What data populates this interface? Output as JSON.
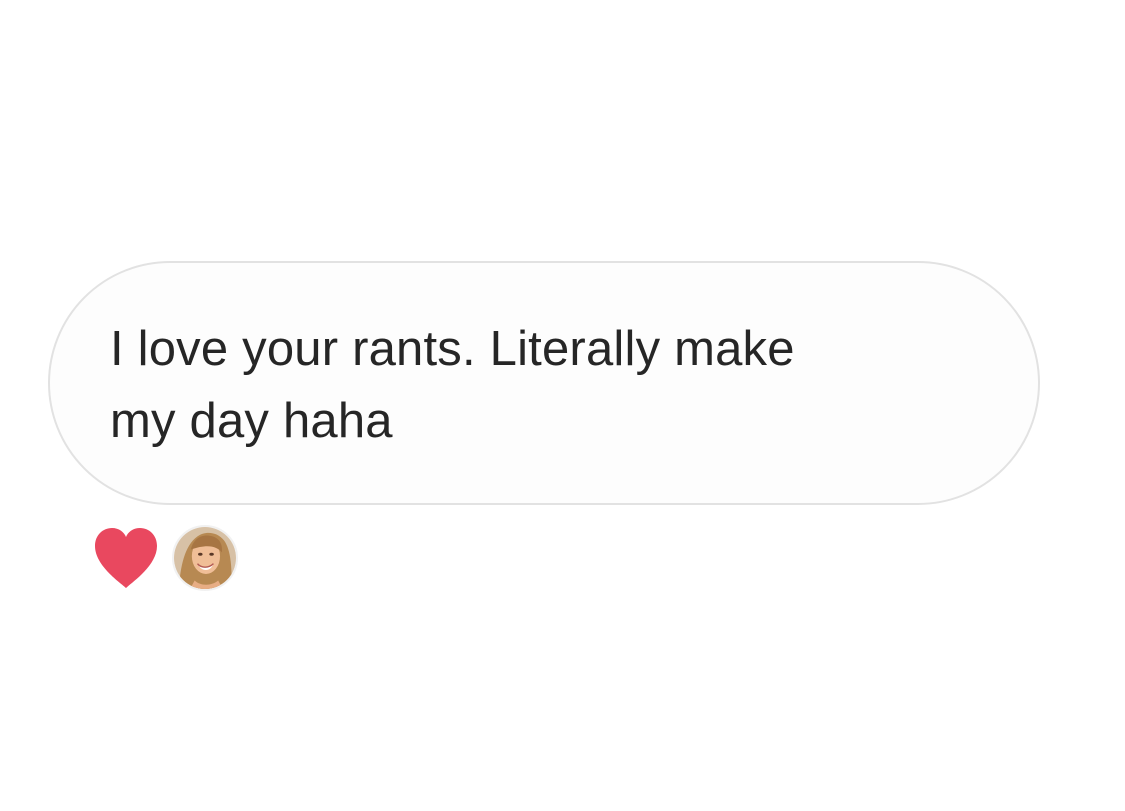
{
  "message": {
    "text_line_1": "I love your rants. Literally make",
    "text_line_2": "my day haha"
  },
  "reactions": {
    "icon": "heart-icon",
    "color": "#e9485f",
    "reactor_avatar": "avatar"
  }
}
